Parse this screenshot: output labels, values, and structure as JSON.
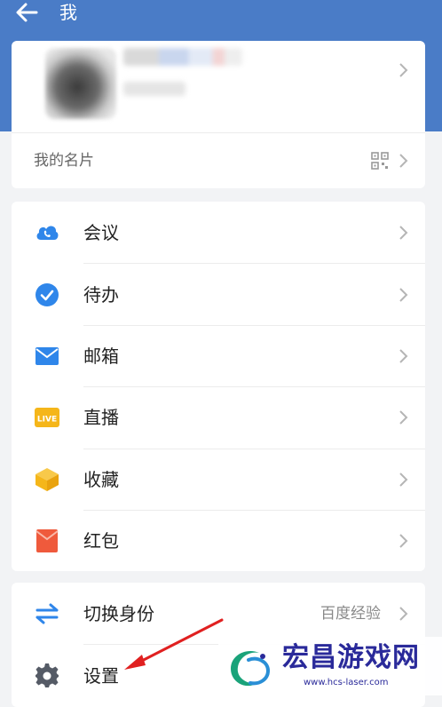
{
  "header": {
    "title": "我"
  },
  "profile": {
    "card_label": "我的名片"
  },
  "menu": {
    "items": [
      {
        "label": "会议",
        "icon": "cloud-phone-icon",
        "color": "#2f86ea"
      },
      {
        "label": "待办",
        "icon": "check-circle-icon",
        "color": "#2f86ea"
      },
      {
        "label": "邮箱",
        "icon": "mail-icon",
        "color": "#2f86ea"
      },
      {
        "label": "直播",
        "icon": "live-badge-icon",
        "color": "#f5b61a",
        "badge_text": "LIVE"
      },
      {
        "label": "收藏",
        "icon": "box-icon",
        "color": "#f5b61a"
      },
      {
        "label": "红包",
        "icon": "red-envelope-icon",
        "color": "#ef5a3c"
      }
    ]
  },
  "bottom": {
    "switch_identity_label": "切换身份",
    "switch_identity_value": "百度经验",
    "settings_label": "设置"
  },
  "watermark": {
    "text": "宏昌游戏网",
    "url": "www.hcs-laser.com"
  },
  "colors": {
    "header_bg": "#4a7cc7",
    "page_bg": "#f2f3f5",
    "annotation_arrow": "#e02020"
  }
}
